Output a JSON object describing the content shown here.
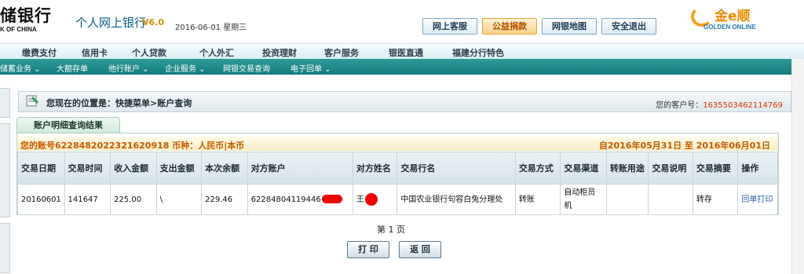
{
  "header": {
    "bank_name": "储银行",
    "bank_sub": "K OF CHINA",
    "app_title": "个人网上银行",
    "version": "V6.0",
    "date": "2016-06-01 星期三",
    "buttons": [
      "网上客服",
      "公益捐款",
      "网银地图",
      "安全退出"
    ],
    "logo_text": "金e顺",
    "logo_sub": "GOLDEN ONLINE"
  },
  "main_nav": [
    "缴费支付",
    "信用卡",
    "个人贷款",
    "个人外汇",
    "投资理财",
    "客户服务",
    "银医直通",
    "福建分行特色"
  ],
  "sub_nav": [
    "储蓄业务",
    "大额存单",
    "他行账户",
    "企业服务",
    "网银交易查询",
    "电子回单"
  ],
  "breadcrumb": {
    "text": "您现在的位置是：快捷菜单>账户查询",
    "customer_label": "您的客户号：",
    "customer_no": "1635503462114769"
  },
  "panel": {
    "tab": "账户明细查询结果",
    "account_info": "您的账号6228482022321620918 币种：人民币|本币",
    "date_range": "自2016年05月31日 至 2016年06月01日"
  },
  "table": {
    "headers": [
      "交易日期",
      "交易时间",
      "收入金额",
      "支出金额",
      "本次余额",
      "对方账户",
      "对方姓名",
      "交易行名",
      "交易方式",
      "交易渠道",
      "转账用途",
      "交易说明",
      "交易摘要",
      "操作"
    ],
    "rows": [
      {
        "date": "20160601",
        "time": "141647",
        "income": "225.00",
        "expense": "\\",
        "balance": "229.46",
        "peer_account": "62284804119446",
        "peer_name": "王",
        "bank_name": "中国农业银行句容白兔分理处",
        "method": "转账",
        "channel": "自动柜员机",
        "purpose": "",
        "note": "",
        "summary": "转存",
        "action": "回单打印"
      }
    ]
  },
  "footer": {
    "page": "第 1 页",
    "print": "打 印",
    "back": "返 回"
  }
}
